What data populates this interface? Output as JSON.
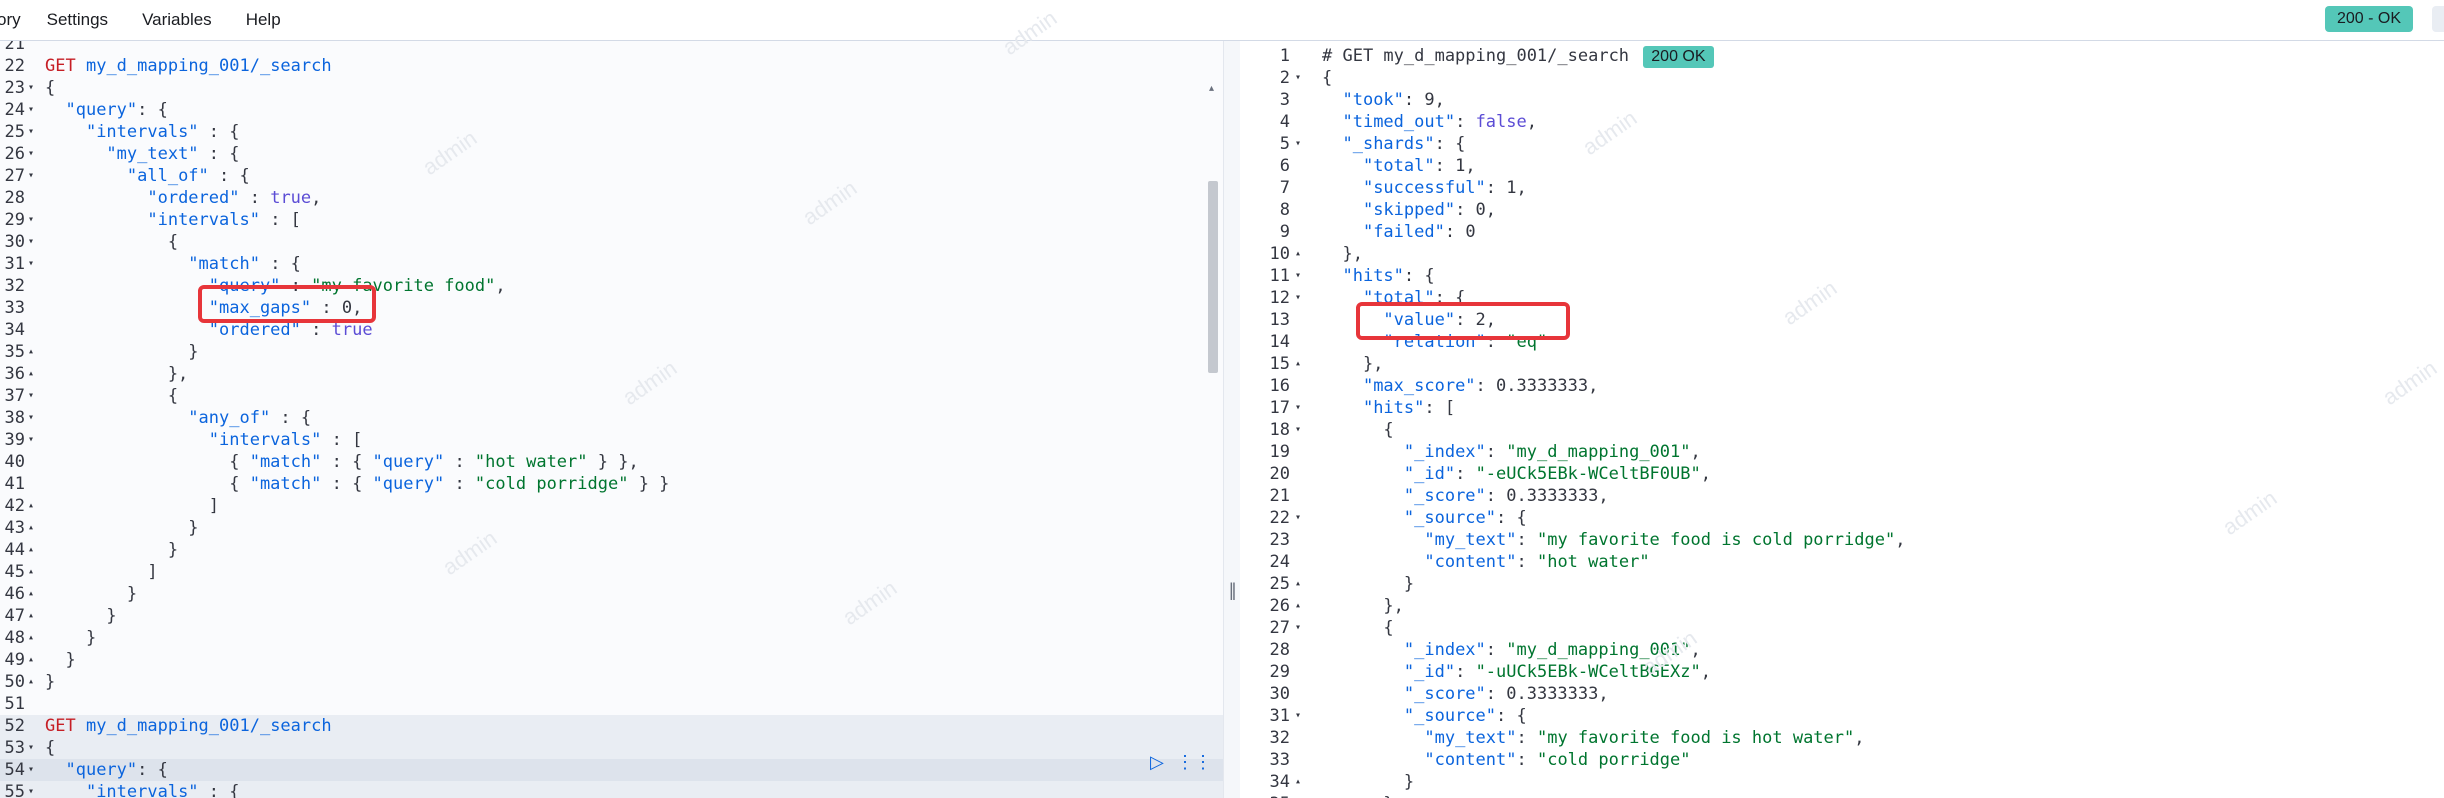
{
  "menu": [
    "ory",
    "Settings",
    "Variables",
    "Help"
  ],
  "status_top": "200 - OK",
  "watermark": "admin",
  "left_lines": [
    {
      "n": "21",
      "f": "",
      "segs": []
    },
    {
      "n": "22",
      "f": "",
      "segs": [
        [
          "m",
          "GET"
        ],
        [
          "n",
          " "
        ],
        [
          "k",
          "my_d_mapping_001/_search"
        ]
      ]
    },
    {
      "n": "23",
      "f": "▾",
      "segs": [
        [
          "n",
          "{"
        ]
      ]
    },
    {
      "n": "24",
      "f": "▾",
      "segs": [
        [
          "n",
          "  "
        ],
        [
          "k",
          "\"query\""
        ],
        [
          "n",
          ": {"
        ]
      ]
    },
    {
      "n": "25",
      "f": "▾",
      "segs": [
        [
          "n",
          "    "
        ],
        [
          "k",
          "\"intervals\""
        ],
        [
          "n",
          " : {"
        ]
      ]
    },
    {
      "n": "26",
      "f": "▾",
      "segs": [
        [
          "n",
          "      "
        ],
        [
          "k",
          "\"my_text\""
        ],
        [
          "n",
          " : {"
        ]
      ]
    },
    {
      "n": "27",
      "f": "▾",
      "segs": [
        [
          "n",
          "        "
        ],
        [
          "k",
          "\"all_of\""
        ],
        [
          "n",
          " : {"
        ]
      ]
    },
    {
      "n": "28",
      "f": "",
      "segs": [
        [
          "n",
          "          "
        ],
        [
          "k",
          "\"ordered\""
        ],
        [
          "n",
          " : "
        ],
        [
          "b",
          "true"
        ],
        [
          "n",
          ","
        ]
      ]
    },
    {
      "n": "29",
      "f": "▾",
      "segs": [
        [
          "n",
          "          "
        ],
        [
          "k",
          "\"intervals\""
        ],
        [
          "n",
          " : ["
        ]
      ]
    },
    {
      "n": "30",
      "f": "▾",
      "segs": [
        [
          "n",
          "            {"
        ]
      ]
    },
    {
      "n": "31",
      "f": "▾",
      "segs": [
        [
          "n",
          "              "
        ],
        [
          "k",
          "\"match\""
        ],
        [
          "n",
          " : {"
        ]
      ]
    },
    {
      "n": "32",
      "f": "",
      "segs": [
        [
          "n",
          "                "
        ],
        [
          "k",
          "\"query\""
        ],
        [
          "n",
          " : "
        ],
        [
          "s",
          "\"my favorite food\""
        ],
        [
          "n",
          ","
        ]
      ]
    },
    {
      "n": "33",
      "f": "",
      "segs": [
        [
          "n",
          "                "
        ],
        [
          "k",
          "\"max_gaps\""
        ],
        [
          "n",
          " : 0,"
        ]
      ]
    },
    {
      "n": "34",
      "f": "",
      "segs": [
        [
          "n",
          "                "
        ],
        [
          "k",
          "\"ordered\""
        ],
        [
          "n",
          " : "
        ],
        [
          "b",
          "true"
        ]
      ]
    },
    {
      "n": "35",
      "f": "▴",
      "segs": [
        [
          "n",
          "              }"
        ]
      ]
    },
    {
      "n": "36",
      "f": "▴",
      "segs": [
        [
          "n",
          "            },"
        ]
      ]
    },
    {
      "n": "37",
      "f": "▾",
      "segs": [
        [
          "n",
          "            {"
        ]
      ]
    },
    {
      "n": "38",
      "f": "▾",
      "segs": [
        [
          "n",
          "              "
        ],
        [
          "k",
          "\"any_of\""
        ],
        [
          "n",
          " : {"
        ]
      ]
    },
    {
      "n": "39",
      "f": "▾",
      "segs": [
        [
          "n",
          "                "
        ],
        [
          "k",
          "\"intervals\""
        ],
        [
          "n",
          " : ["
        ]
      ]
    },
    {
      "n": "40",
      "f": "",
      "segs": [
        [
          "n",
          "                  { "
        ],
        [
          "k",
          "\"match\""
        ],
        [
          "n",
          " : { "
        ],
        [
          "k",
          "\"query\""
        ],
        [
          "n",
          " : "
        ],
        [
          "s",
          "\"hot water\""
        ],
        [
          "n",
          " } },"
        ]
      ]
    },
    {
      "n": "41",
      "f": "",
      "segs": [
        [
          "n",
          "                  { "
        ],
        [
          "k",
          "\"match\""
        ],
        [
          "n",
          " : { "
        ],
        [
          "k",
          "\"query\""
        ],
        [
          "n",
          " : "
        ],
        [
          "s",
          "\"cold porridge\""
        ],
        [
          "n",
          " } }"
        ]
      ]
    },
    {
      "n": "42",
      "f": "▴",
      "segs": [
        [
          "n",
          "                ]"
        ]
      ]
    },
    {
      "n": "43",
      "f": "▴",
      "segs": [
        [
          "n",
          "              }"
        ]
      ]
    },
    {
      "n": "44",
      "f": "▴",
      "segs": [
        [
          "n",
          "            }"
        ]
      ]
    },
    {
      "n": "45",
      "f": "▴",
      "segs": [
        [
          "n",
          "          ]"
        ]
      ]
    },
    {
      "n": "46",
      "f": "▴",
      "segs": [
        [
          "n",
          "        }"
        ]
      ]
    },
    {
      "n": "47",
      "f": "▴",
      "segs": [
        [
          "n",
          "      }"
        ]
      ]
    },
    {
      "n": "48",
      "f": "▴",
      "segs": [
        [
          "n",
          "    }"
        ]
      ]
    },
    {
      "n": "49",
      "f": "▴",
      "segs": [
        [
          "n",
          "  }"
        ]
      ]
    },
    {
      "n": "50",
      "f": "▴",
      "segs": [
        [
          "n",
          "}"
        ]
      ]
    },
    {
      "n": "51",
      "f": "",
      "segs": []
    },
    {
      "n": "52",
      "f": "",
      "cls": "hl-line",
      "segs": [
        [
          "m",
          "GET"
        ],
        [
          "n",
          " "
        ],
        [
          "k",
          "my_d_mapping_001/_search"
        ]
      ]
    },
    {
      "n": "53",
      "f": "▾",
      "cls": "hl-line",
      "segs": [
        [
          "n",
          "{"
        ]
      ]
    },
    {
      "n": "54",
      "f": "▾",
      "cls": "sel-line",
      "segs": [
        [
          "n",
          "  "
        ],
        [
          "k",
          "\"query\""
        ],
        [
          "n",
          ": {"
        ]
      ]
    },
    {
      "n": "55",
      "f": "▾",
      "cls": "hl-line",
      "segs": [
        [
          "n",
          "    "
        ],
        [
          "k",
          "\"intervals\""
        ],
        [
          "n",
          " : {"
        ]
      ]
    }
  ],
  "right_lines": [
    {
      "n": "1",
      "f": "",
      "segs": [
        [
          "cm",
          "# GET my_d_mapping_001/_search "
        ]
      ],
      "badge": "200 OK"
    },
    {
      "n": "2",
      "f": "▾",
      "segs": [
        [
          "n",
          "{"
        ]
      ]
    },
    {
      "n": "3",
      "f": "",
      "segs": [
        [
          "n",
          "  "
        ],
        [
          "k",
          "\"took\""
        ],
        [
          "n",
          ": 9,"
        ]
      ]
    },
    {
      "n": "4",
      "f": "",
      "segs": [
        [
          "n",
          "  "
        ],
        [
          "k",
          "\"timed_out\""
        ],
        [
          "n",
          ": "
        ],
        [
          "b",
          "false"
        ],
        [
          "n",
          ","
        ]
      ]
    },
    {
      "n": "5",
      "f": "▾",
      "segs": [
        [
          "n",
          "  "
        ],
        [
          "k",
          "\"_shards\""
        ],
        [
          "n",
          ": {"
        ]
      ]
    },
    {
      "n": "6",
      "f": "",
      "segs": [
        [
          "n",
          "    "
        ],
        [
          "k",
          "\"total\""
        ],
        [
          "n",
          ": 1,"
        ]
      ]
    },
    {
      "n": "7",
      "f": "",
      "segs": [
        [
          "n",
          "    "
        ],
        [
          "k",
          "\"successful\""
        ],
        [
          "n",
          ": 1,"
        ]
      ]
    },
    {
      "n": "8",
      "f": "",
      "segs": [
        [
          "n",
          "    "
        ],
        [
          "k",
          "\"skipped\""
        ],
        [
          "n",
          ": 0,"
        ]
      ]
    },
    {
      "n": "9",
      "f": "",
      "segs": [
        [
          "n",
          "    "
        ],
        [
          "k",
          "\"failed\""
        ],
        [
          "n",
          ": 0"
        ]
      ]
    },
    {
      "n": "10",
      "f": "▴",
      "segs": [
        [
          "n",
          "  },"
        ]
      ]
    },
    {
      "n": "11",
      "f": "▾",
      "segs": [
        [
          "n",
          "  "
        ],
        [
          "k",
          "\"hits\""
        ],
        [
          "n",
          ": {"
        ]
      ]
    },
    {
      "n": "12",
      "f": "▾",
      "segs": [
        [
          "n",
          "    "
        ],
        [
          "k",
          "\"total\""
        ],
        [
          "n",
          ": {"
        ]
      ]
    },
    {
      "n": "13",
      "f": "",
      "segs": [
        [
          "n",
          "      "
        ],
        [
          "k",
          "\"value\""
        ],
        [
          "n",
          ": 2,"
        ]
      ]
    },
    {
      "n": "14",
      "f": "",
      "segs": [
        [
          "n",
          "      "
        ],
        [
          "k",
          "\"relation\""
        ],
        [
          "n",
          ": "
        ],
        [
          "s",
          "\"eq\""
        ]
      ]
    },
    {
      "n": "15",
      "f": "▴",
      "segs": [
        [
          "n",
          "    },"
        ]
      ]
    },
    {
      "n": "16",
      "f": "",
      "segs": [
        [
          "n",
          "    "
        ],
        [
          "k",
          "\"max_score\""
        ],
        [
          "n",
          ": 0.3333333,"
        ]
      ]
    },
    {
      "n": "17",
      "f": "▾",
      "segs": [
        [
          "n",
          "    "
        ],
        [
          "k",
          "\"hits\""
        ],
        [
          "n",
          ": ["
        ]
      ]
    },
    {
      "n": "18",
      "f": "▾",
      "segs": [
        [
          "n",
          "      {"
        ]
      ]
    },
    {
      "n": "19",
      "f": "",
      "segs": [
        [
          "n",
          "        "
        ],
        [
          "k",
          "\"_index\""
        ],
        [
          "n",
          ": "
        ],
        [
          "s",
          "\"my_d_mapping_001\""
        ],
        [
          "n",
          ","
        ]
      ]
    },
    {
      "n": "20",
      "f": "",
      "segs": [
        [
          "n",
          "        "
        ],
        [
          "k",
          "\"_id\""
        ],
        [
          "n",
          ": "
        ],
        [
          "s",
          "\"-eUCk5EBk-WCeltBF0UB\""
        ],
        [
          "n",
          ","
        ]
      ]
    },
    {
      "n": "21",
      "f": "",
      "segs": [
        [
          "n",
          "        "
        ],
        [
          "k",
          "\"_score\""
        ],
        [
          "n",
          ": 0.3333333,"
        ]
      ]
    },
    {
      "n": "22",
      "f": "▾",
      "segs": [
        [
          "n",
          "        "
        ],
        [
          "k",
          "\"_source\""
        ],
        [
          "n",
          ": {"
        ]
      ]
    },
    {
      "n": "23",
      "f": "",
      "segs": [
        [
          "n",
          "          "
        ],
        [
          "k",
          "\"my_text\""
        ],
        [
          "n",
          ": "
        ],
        [
          "s",
          "\"my favorite food is cold porridge\""
        ],
        [
          "n",
          ","
        ]
      ]
    },
    {
      "n": "24",
      "f": "",
      "segs": [
        [
          "n",
          "          "
        ],
        [
          "k",
          "\"content\""
        ],
        [
          "n",
          ": "
        ],
        [
          "s",
          "\"hot water\""
        ]
      ]
    },
    {
      "n": "25",
      "f": "▴",
      "segs": [
        [
          "n",
          "        }"
        ]
      ]
    },
    {
      "n": "26",
      "f": "▴",
      "segs": [
        [
          "n",
          "      },"
        ]
      ]
    },
    {
      "n": "27",
      "f": "▾",
      "segs": [
        [
          "n",
          "      {"
        ]
      ]
    },
    {
      "n": "28",
      "f": "",
      "segs": [
        [
          "n",
          "        "
        ],
        [
          "k",
          "\"_index\""
        ],
        [
          "n",
          ": "
        ],
        [
          "s",
          "\"my_d_mapping_001\""
        ],
        [
          "n",
          ","
        ]
      ]
    },
    {
      "n": "29",
      "f": "",
      "segs": [
        [
          "n",
          "        "
        ],
        [
          "k",
          "\"_id\""
        ],
        [
          "n",
          ": "
        ],
        [
          "s",
          "\"-uUCk5EBk-WCeltBGEXz\""
        ],
        [
          "n",
          ","
        ]
      ]
    },
    {
      "n": "30",
      "f": "",
      "segs": [
        [
          "n",
          "        "
        ],
        [
          "k",
          "\"_score\""
        ],
        [
          "n",
          ": 0.3333333,"
        ]
      ]
    },
    {
      "n": "31",
      "f": "▾",
      "segs": [
        [
          "n",
          "        "
        ],
        [
          "k",
          "\"_source\""
        ],
        [
          "n",
          ": {"
        ]
      ]
    },
    {
      "n": "32",
      "f": "",
      "segs": [
        [
          "n",
          "          "
        ],
        [
          "k",
          "\"my_text\""
        ],
        [
          "n",
          ": "
        ],
        [
          "s",
          "\"my favorite food is hot water\""
        ],
        [
          "n",
          ","
        ]
      ]
    },
    {
      "n": "33",
      "f": "",
      "segs": [
        [
          "n",
          "          "
        ],
        [
          "k",
          "\"content\""
        ],
        [
          "n",
          ": "
        ],
        [
          "s",
          "\"cold porridge\""
        ]
      ]
    },
    {
      "n": "34",
      "f": "▴",
      "segs": [
        [
          "n",
          "        }"
        ]
      ]
    },
    {
      "n": "35",
      "f": "",
      "segs": [
        [
          "n",
          "      }"
        ]
      ]
    }
  ]
}
